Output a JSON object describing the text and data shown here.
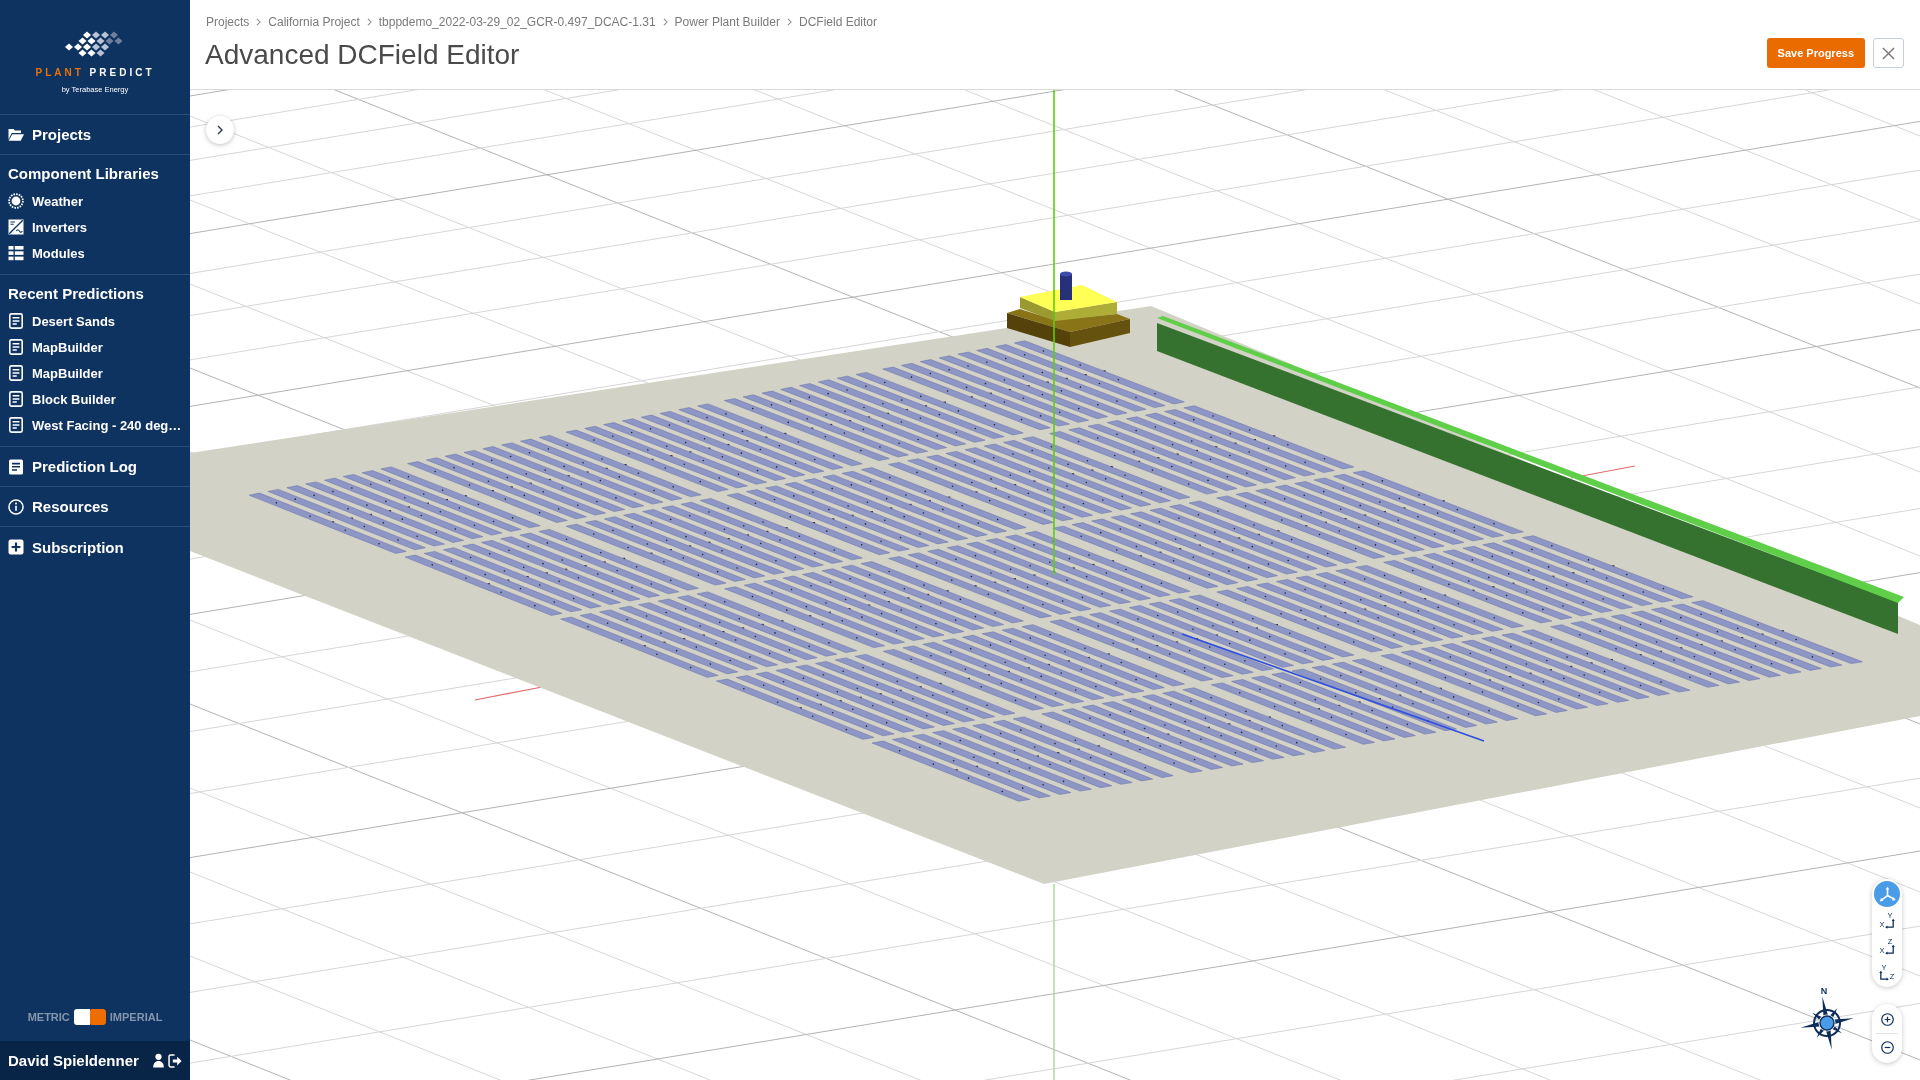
{
  "sidebar": {
    "logo": {
      "wordmark": [
        {
          "text": "PLANT",
          "color": "#e8710a"
        },
        {
          "text": "PREDICT",
          "color": "#ffffff"
        }
      ],
      "tagline": "by Terabase Energy"
    },
    "nav": [
      {
        "kind": "projects",
        "label": "Projects"
      },
      {
        "kind": "section",
        "title": "Component Libraries",
        "items": [
          {
            "kind": "weather",
            "label": "Weather"
          },
          {
            "kind": "inverters",
            "label": "Inverters"
          },
          {
            "kind": "modules",
            "label": "Modules"
          }
        ]
      },
      {
        "kind": "section",
        "title": "Recent Predictions",
        "items": [
          {
            "kind": "prediction",
            "label": "Desert Sands"
          },
          {
            "kind": "prediction",
            "label": "MapBuilder"
          },
          {
            "kind": "prediction",
            "label": "MapBuilder"
          },
          {
            "kind": "prediction",
            "label": "Block Builder"
          },
          {
            "kind": "prediction",
            "label": "West Facing - 240 deg…"
          }
        ]
      },
      {
        "kind": "log",
        "label": "Prediction Log"
      },
      {
        "kind": "resources",
        "label": "Resources"
      },
      {
        "kind": "subscription",
        "label": "Subscription"
      }
    ],
    "units": {
      "options": [
        {
          "label": "METRIC",
          "selected": false
        },
        {
          "label": "IMPERIAL",
          "selected": true
        }
      ]
    },
    "user": {
      "name": "David Spieldenner"
    }
  },
  "header": {
    "breadcrumb": [
      "Projects",
      "California Project",
      "tbppdemo_2022-03-29_02_GCR-0.497_DCAC-1.31",
      "Power Plant Builder",
      "DCField Editor"
    ],
    "title": "Advanced DCField Editor",
    "save_button": "Save Progress"
  },
  "viewport": {
    "view_buttons": [
      {
        "kind": "perspective",
        "selected": true
      },
      {
        "kind": "front",
        "horizontal": "X",
        "vertical": "Y",
        "selected": false
      },
      {
        "kind": "top",
        "horizontal": "X",
        "vertical": "Z",
        "selected": false
      },
      {
        "kind": "side",
        "horizontal": "Z",
        "vertical": "Y",
        "selected": false
      }
    ],
    "compass": {
      "north": "N"
    }
  }
}
